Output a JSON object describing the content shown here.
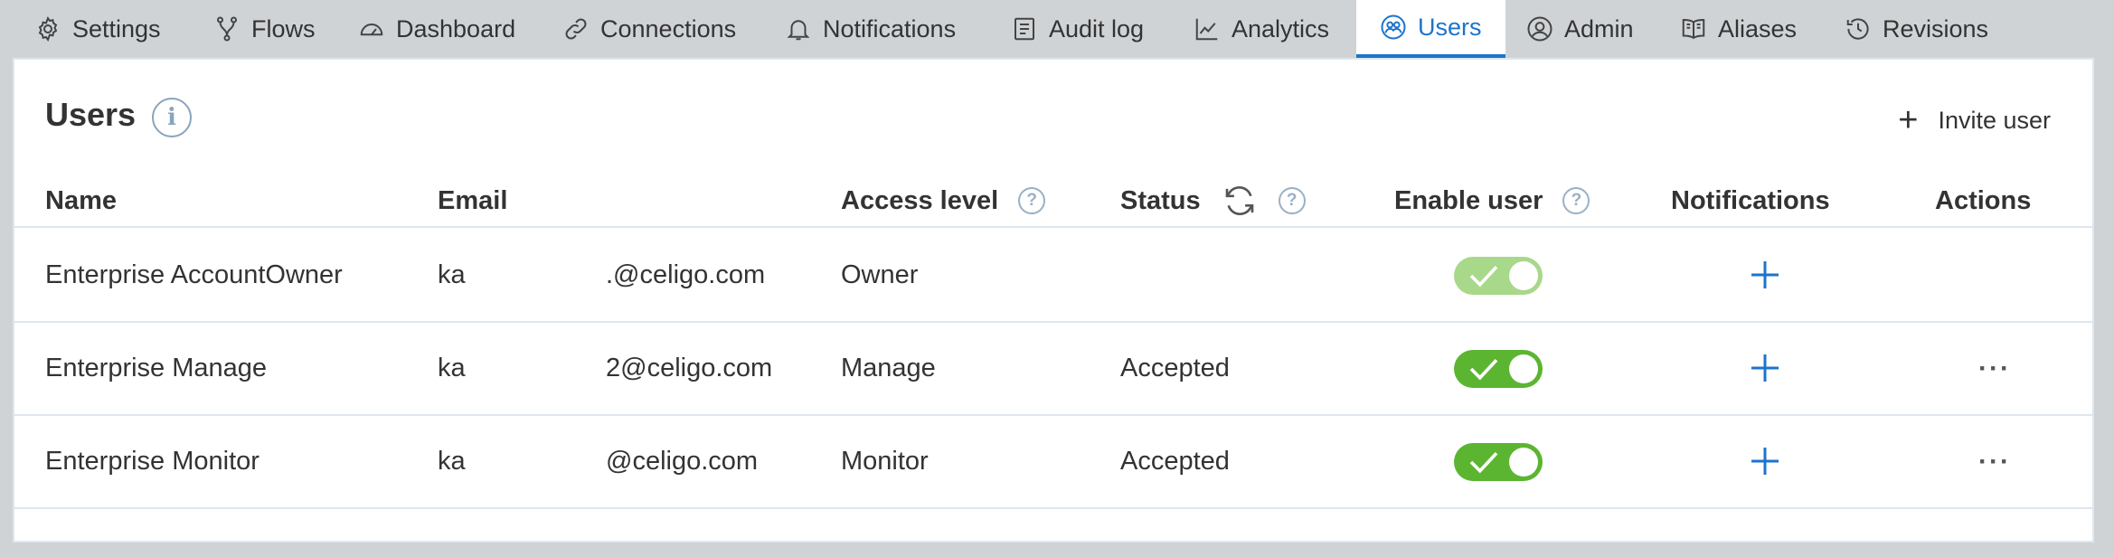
{
  "tabs": [
    {
      "label": "Settings",
      "icon": "gear-icon"
    },
    {
      "label": "Flows",
      "icon": "flows-icon"
    },
    {
      "label": "Dashboard",
      "icon": "dashboard-icon"
    },
    {
      "label": "Connections",
      "icon": "link-icon"
    },
    {
      "label": "Notifications",
      "icon": "bell-icon"
    },
    {
      "label": "Audit log",
      "icon": "audit-log-icon"
    },
    {
      "label": "Analytics",
      "icon": "analytics-icon"
    },
    {
      "label": "Users",
      "icon": "users-icon",
      "active": true
    },
    {
      "label": "Admin",
      "icon": "admin-icon"
    },
    {
      "label": "Aliases",
      "icon": "book-icon"
    },
    {
      "label": "Revisions",
      "icon": "history-icon"
    }
  ],
  "page": {
    "title": "Users",
    "info_glyph": "i",
    "invite_label": "Invite user"
  },
  "columns": {
    "name": "Name",
    "email": "Email",
    "access": "Access level",
    "status": "Status",
    "enable": "Enable user",
    "notifications": "Notifications",
    "actions": "Actions",
    "help_glyph": "?"
  },
  "rows": [
    {
      "name": "Enterprise AccountOwner",
      "email_prefix": "ka",
      "email_suffix": ".@celigo.com",
      "access": "Owner",
      "status": "",
      "enabled": true,
      "toggle_disabled": true,
      "has_actions": false
    },
    {
      "name": "Enterprise Manage",
      "email_prefix": "ka",
      "email_suffix": "2@celigo.com",
      "access": "Manage",
      "status": "Accepted",
      "enabled": true,
      "toggle_disabled": false,
      "has_actions": true
    },
    {
      "name": "Enterprise Monitor",
      "email_prefix": "ka",
      "email_suffix": "@celigo.com",
      "access": "Monitor",
      "status": "Accepted",
      "enabled": true,
      "toggle_disabled": false,
      "has_actions": true
    }
  ],
  "more_glyph": "···",
  "colors": {
    "accent": "#1c74cc",
    "toggle_on": "#5cb531",
    "toggle_disabled": "#a8d88a"
  }
}
